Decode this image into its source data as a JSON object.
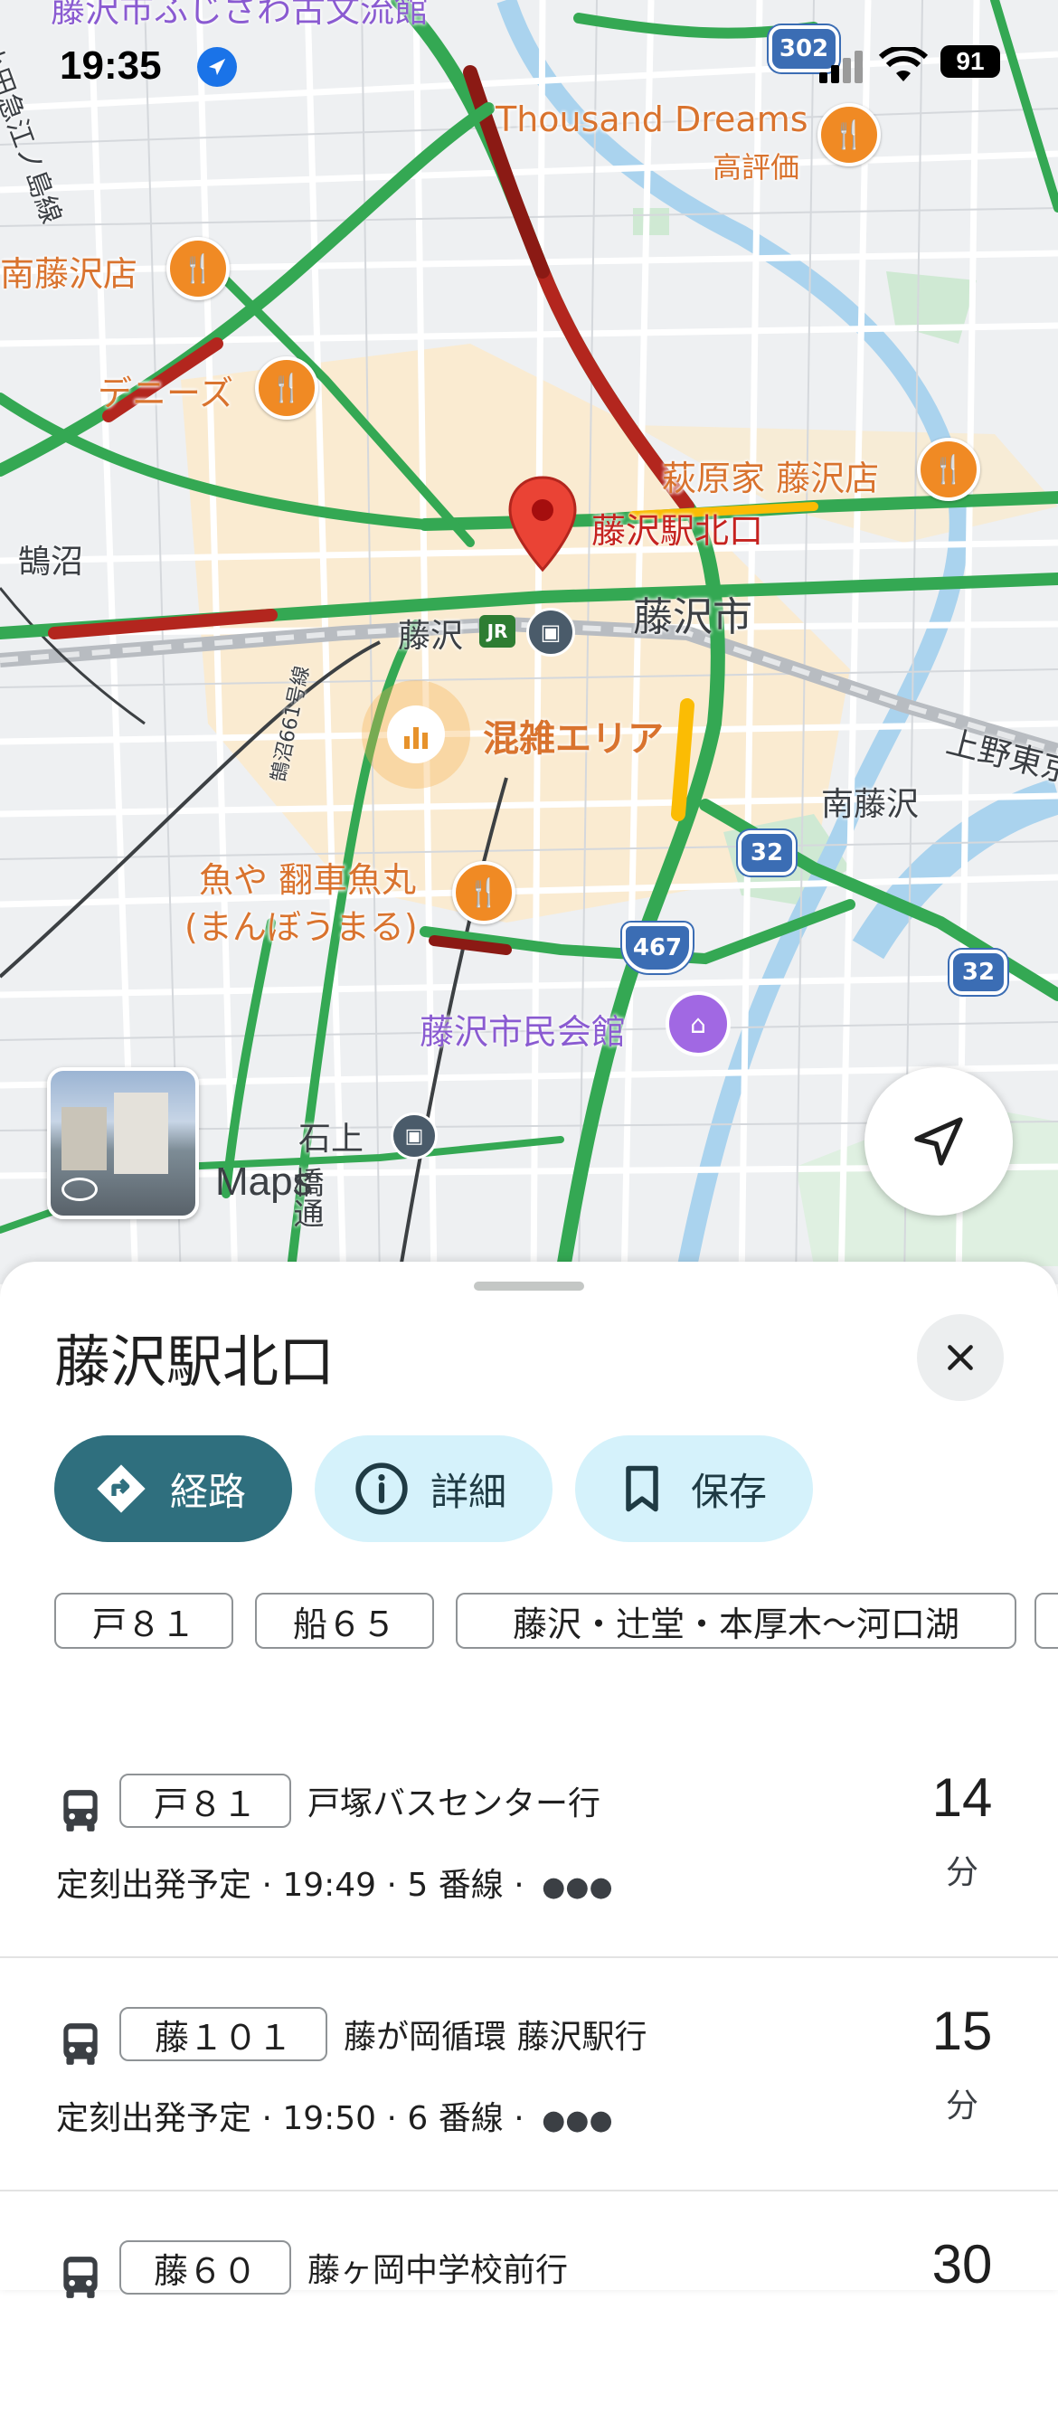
{
  "status_bar": {
    "time": "19:35",
    "battery": "91"
  },
  "map": {
    "labels": {
      "fujisawa_cultural": "藤沢市ふじさわ古文流館",
      "thousand_dreams": "Thousand Dreams",
      "thousand_dreams_sub": "高評価",
      "minami_fujisawa_store": "南藤沢店",
      "dennys": "デニーズ",
      "ogiwaraya": "萩原家 藤沢店",
      "north_exit": "藤沢駅北口",
      "kugenuma": "鵠沼",
      "fujisawa_city": "藤沢市",
      "fujisawa_station": "藤沢",
      "crowded": "混雑エリア",
      "minami_fujisawa": "南藤沢",
      "ueno_tokyo": "上野東京",
      "uoya_1": "魚や 翻車魚丸",
      "uoya_2": "(まんぼうまる)",
      "civic_hall": "藤沢市民会館",
      "ishigami": "石上",
      "road_661": "鵠沼661号線",
      "left_line": "小田急江ノ島線",
      "hashi": "橋通"
    },
    "shields": {
      "r302": "302",
      "r32a": "32",
      "r32b": "32",
      "r467": "467"
    },
    "street_view_label": "Maps"
  },
  "place": {
    "title": "藤沢駅北口",
    "actions": {
      "route": "経路",
      "details": "詳細",
      "save": "保存"
    },
    "route_chips": [
      "戸８１",
      "船６５",
      "藤沢・辻堂・本厚木〜河口湖"
    ]
  },
  "departures": [
    {
      "route": "戸８１",
      "destination": "戸塚バスセンター行",
      "info": "定刻出発予定 · 19:49 · 5 番線 ·",
      "minutes": "14",
      "unit": "分"
    },
    {
      "route": "藤１０１",
      "destination": "藤が岡循環 藤沢駅行",
      "info": "定刻出発予定 · 19:50 · 6 番線 ·",
      "minutes": "15",
      "unit": "分"
    },
    {
      "route": "藤６０",
      "destination": "藤ヶ岡中学校前行",
      "info": "",
      "minutes": "30",
      "unit": ""
    }
  ],
  "colors": {
    "accent": "#2f6f7e",
    "chip_bg": "#d5f2fb",
    "traffic_green": "#34a853",
    "traffic_red": "#b3261e",
    "traffic_yellow": "#fbbc04"
  }
}
